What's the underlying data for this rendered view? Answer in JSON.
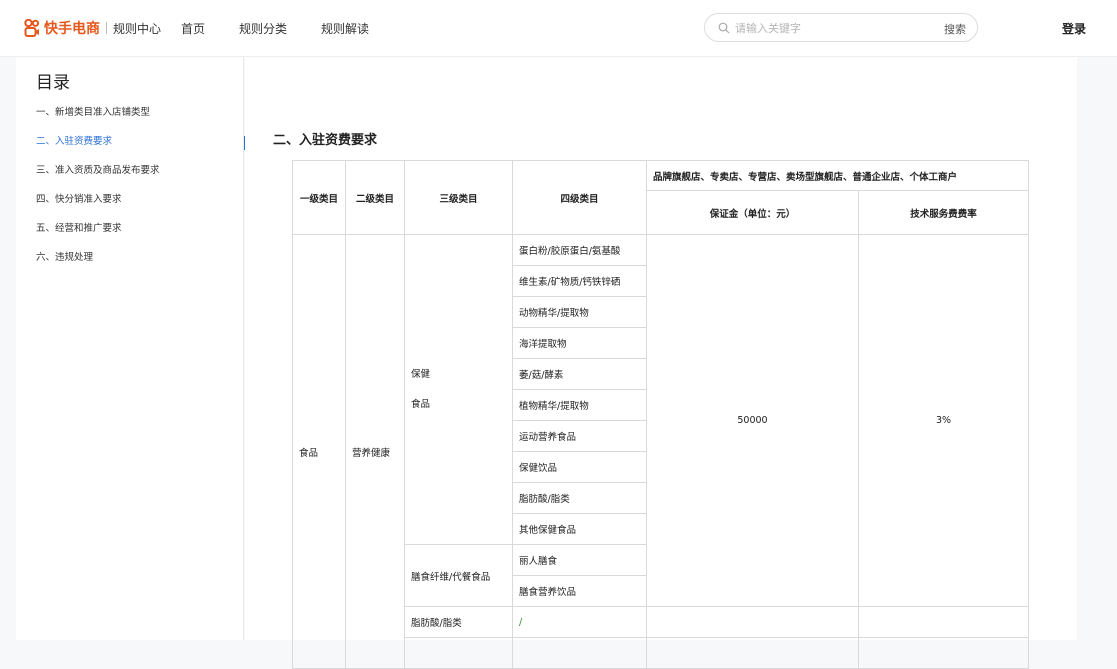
{
  "header": {
    "brand": "快手电商",
    "sub": "规则中心",
    "nav": [
      "首页",
      "规则分类",
      "规则解读"
    ],
    "search_placeholder": "请输入关键字",
    "search_button": "搜索",
    "login": "登录",
    "brand_color": "#e6591e"
  },
  "sidebar": {
    "title": "目录",
    "items": [
      {
        "label": "一、新增类目准入店铺类型"
      },
      {
        "label": "二、入驻资费要求"
      },
      {
        "label": "三、准入资质及商品发布要求"
      },
      {
        "label": "四、快分销准入要求"
      },
      {
        "label": "五、经营和推广要求"
      },
      {
        "label": "六、违规处理"
      }
    ],
    "active_index": 1,
    "active_color": "#2a6fd6"
  },
  "main": {
    "section_title": "二、入驻资费要求",
    "table": {
      "headers": {
        "lv1": "一级类目",
        "lv2": "二级类目",
        "lv3": "三级类目",
        "lv4": "四级类目",
        "shop_types": "品牌旗舰店、专卖店、专营店、卖场型旗舰店、普通企业店、个体工商户",
        "deposit": "保证金（单位：元）",
        "fee": "技术服务费费率"
      },
      "lv1": "食品",
      "lv2": "营养健康",
      "groups": [
        {
          "lv3_line1": "保健",
          "lv3_line2": "食品",
          "lv4": [
            "蛋白粉/胶原蛋白/氨基酸",
            "维生素/矿物质/钙铁锌硒",
            "动物精华/提取物",
            "海洋提取物",
            "萎/菇/酵素",
            "植物精华/提取物",
            "运动营养食品",
            "保健饮品",
            "脂肪酸/脂类",
            "其他保健食品"
          ]
        },
        {
          "lv3": "膳食纤维/代餐食品",
          "lv4": [
            "丽人膳食",
            "膳食营养饮品"
          ]
        },
        {
          "lv3": "脂肪酸/脂类",
          "lv4": [
            "/"
          ]
        }
      ],
      "deposit": "50000",
      "fee": "3%"
    }
  }
}
